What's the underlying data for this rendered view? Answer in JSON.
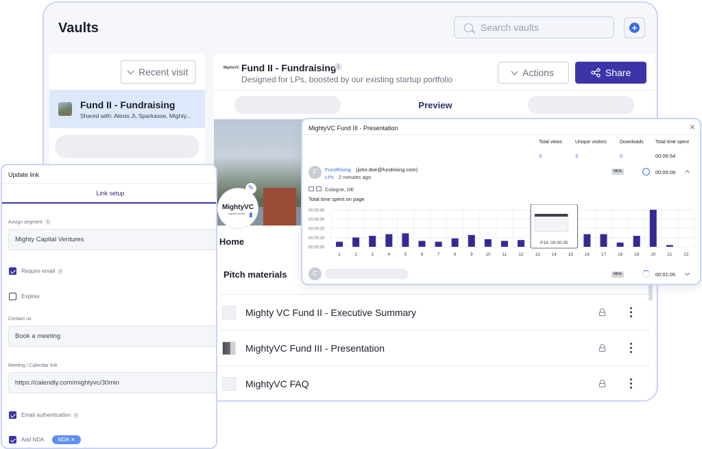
{
  "vaults": {
    "title": "Vaults",
    "search_placeholder": "Search vaults",
    "recent_label": "Recent visit",
    "vault_item": {
      "title": "Fund II - Fundraising",
      "shared": "Shared with: Alexis Ji, Sparkasse, Mighty..."
    }
  },
  "fund": {
    "logo": "MightyVC",
    "title": "Fund II - Fundraising",
    "subtitle": "Designed for LPs, boosted by our existing startup portfolio",
    "actions_label": "Actions",
    "share_label": "Share",
    "preview_tab": "Preview",
    "hero_logo": "MightyVC",
    "hero_logo_sub": "Capital Ventures",
    "home_label": "Home",
    "pitch_label": "Pitch materials",
    "documents": [
      {
        "title": "Mighty VC Fund II - Executive Summary"
      },
      {
        "title": "MightyVC Fund III - Presentation"
      },
      {
        "title": "MightyVC FAQ"
      }
    ]
  },
  "analytics": {
    "title": "MightyVC Fund III - Presentation",
    "stats": {
      "headers": [
        "Total views",
        "Unique visitors",
        "Downloads",
        "Total time spent"
      ],
      "values": [
        "3",
        "3",
        "0",
        "00:06:54"
      ]
    },
    "visitor1": {
      "initial": "F",
      "name": "FundRising",
      "email": "(john.doe@fundrising.com)",
      "segment": "LPs",
      "time_ago": "2 minutes ago",
      "nda": "NDA",
      "duration": "00:05:09",
      "location": "Cologne, DE"
    },
    "visitor2": {
      "initial": "C",
      "nda": "NDA",
      "duration": "00:01:05"
    },
    "chart_label": "Total time spent on page",
    "tooltip": "P14: 00:00:35"
  },
  "chart_data": {
    "type": "bar",
    "title": "Total time spent on page",
    "categories": [
      "1",
      "2",
      "3",
      "4",
      "5",
      "6",
      "7",
      "8",
      "9",
      "10",
      "11",
      "12",
      "13",
      "14",
      "15",
      "16",
      "17",
      "18",
      "19",
      "20",
      "21",
      "22"
    ],
    "values": [
      6,
      11,
      13,
      15,
      16,
      7,
      6,
      10,
      14,
      9,
      7,
      8,
      0,
      0,
      0,
      15,
      15,
      5,
      13,
      44,
      2,
      0
    ],
    "y_ticks": [
      "00:00:00",
      "00:00:10",
      "00:00:20",
      "00:00:30",
      "00:00:40"
    ],
    "ylim": [
      0,
      44
    ],
    "y_unit": "seconds",
    "color": "#352a94",
    "grid": true
  },
  "update_link": {
    "title": "Update link",
    "tab": "Link setup",
    "assign_label": "Assign segment",
    "assign_value": "Mighty Capital Ventures",
    "require_email": "Require email",
    "expires": "Expires",
    "contact_label": "Contact us",
    "contact_value": "Book a meeting",
    "meeting_label": "Meeting / Calendar link",
    "meeting_value": "https://calendly.com/mightyvc/30min",
    "email_auth": "Email authentication",
    "add_nda": "Add NDA",
    "nda_chip": "NDA ✕"
  },
  "colors": {
    "accent": "#3d35a7",
    "link": "#3c6ddf",
    "border": "#c9d5f3"
  }
}
